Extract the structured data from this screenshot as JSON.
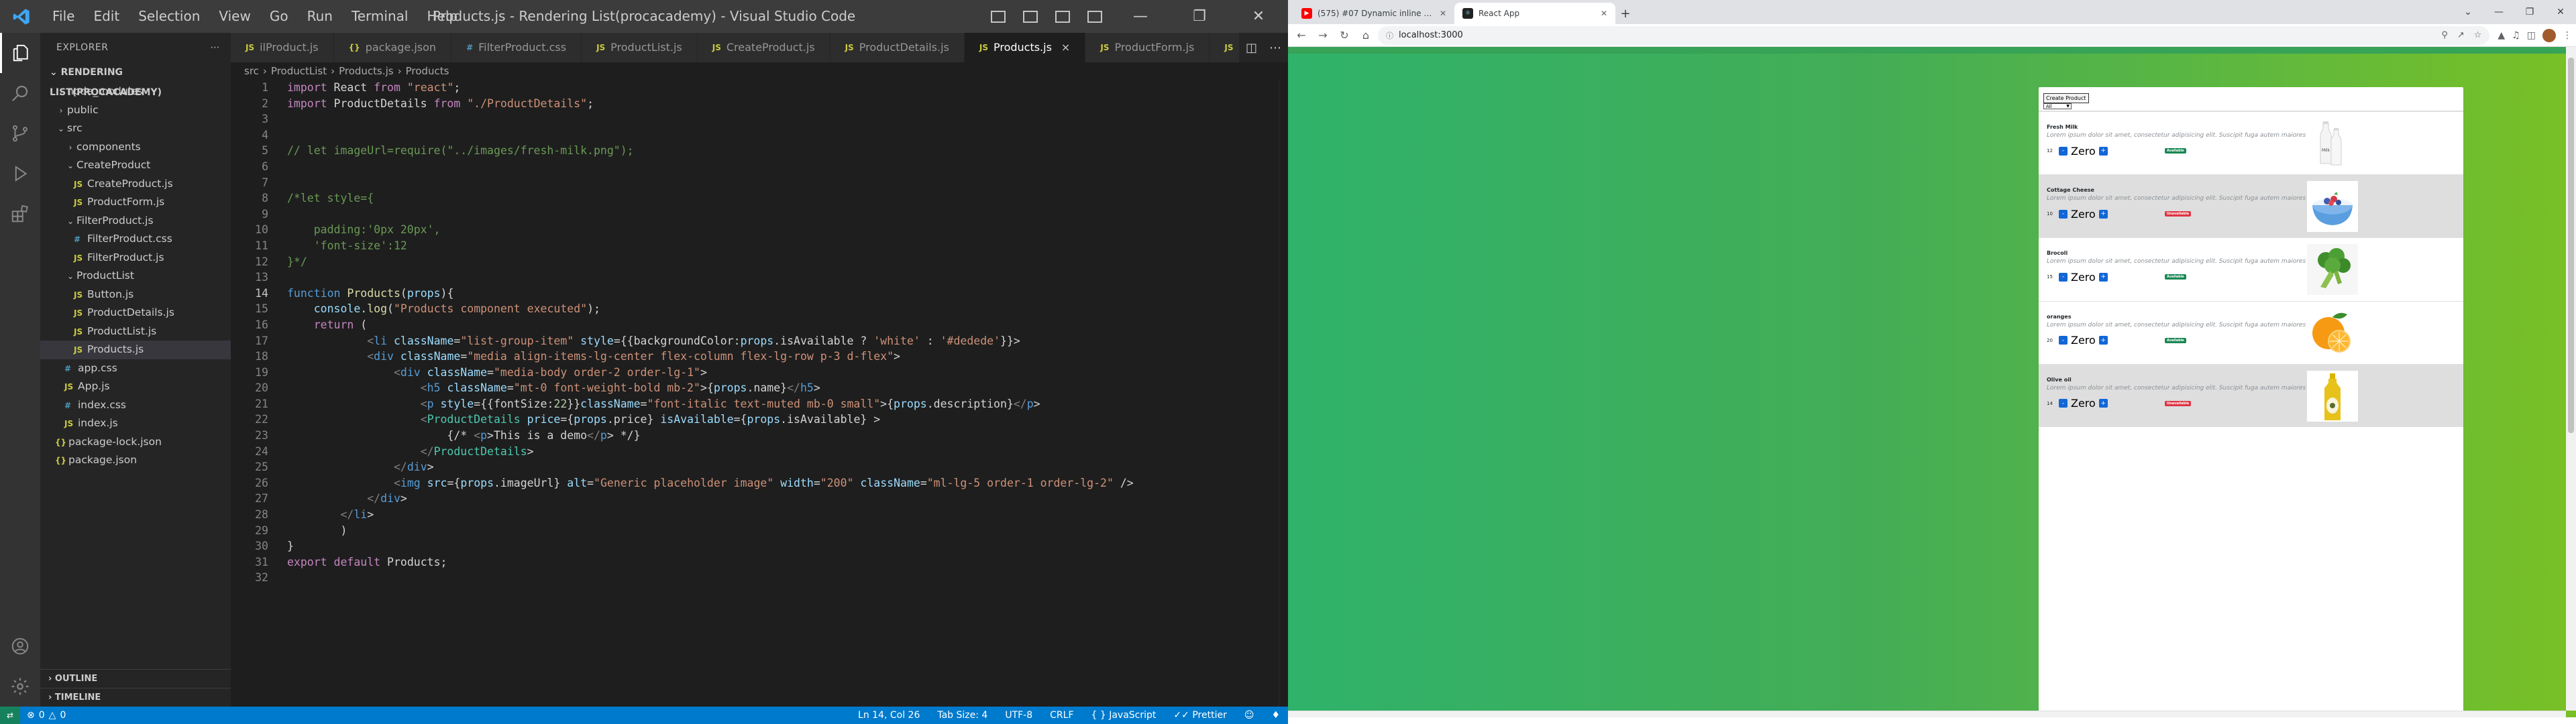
{
  "vscode": {
    "title": "Products.js - Rendering List(procacademy) - Visual Studio Code",
    "menu": [
      "File",
      "Edit",
      "Selection",
      "View",
      "Go",
      "Run",
      "Terminal",
      "Help"
    ],
    "explorer_header": "EXPLORER",
    "project": "RENDERING LIST(PROCACADEMY)",
    "tree": [
      {
        "label": "node_modules",
        "kind": "folder",
        "depth": 0,
        "open": false
      },
      {
        "label": "public",
        "kind": "folder",
        "depth": 0,
        "open": false
      },
      {
        "label": "src",
        "kind": "folder",
        "depth": 0,
        "open": true
      },
      {
        "label": "components",
        "kind": "folder",
        "depth": 1,
        "open": false
      },
      {
        "label": "CreateProduct",
        "kind": "folder",
        "depth": 1,
        "open": true
      },
      {
        "label": "CreateProduct.js",
        "kind": "js",
        "depth": 2
      },
      {
        "label": "ProductForm.js",
        "kind": "js",
        "depth": 2
      },
      {
        "label": "FilterProduct.js",
        "kind": "folder",
        "depth": 1,
        "open": true
      },
      {
        "label": "FilterProduct.css",
        "kind": "css",
        "depth": 2
      },
      {
        "label": "FilterProduct.js",
        "kind": "js",
        "depth": 2
      },
      {
        "label": "ProductList",
        "kind": "folder",
        "depth": 1,
        "open": true
      },
      {
        "label": "Button.js",
        "kind": "js",
        "depth": 2
      },
      {
        "label": "ProductDetails.js",
        "kind": "js",
        "depth": 2
      },
      {
        "label": "ProductList.js",
        "kind": "js",
        "depth": 2
      },
      {
        "label": "Products.js",
        "kind": "js",
        "depth": 2,
        "selected": true
      },
      {
        "label": "app.css",
        "kind": "css",
        "depth": 1
      },
      {
        "label": "App.js",
        "kind": "js",
        "depth": 1
      },
      {
        "label": "index.css",
        "kind": "css",
        "depth": 1
      },
      {
        "label": "index.js",
        "kind": "js",
        "depth": 1
      },
      {
        "label": "package-lock.json",
        "kind": "json",
        "depth": 0
      },
      {
        "label": "package.json",
        "kind": "json",
        "depth": 0
      }
    ],
    "outline_label": "OUTLINE",
    "timeline_label": "TIMELINE",
    "tabs": [
      {
        "label": "ilProduct.js",
        "kind": "js"
      },
      {
        "label": "package.json",
        "kind": "json"
      },
      {
        "label": "FilterProduct.css",
        "kind": "css"
      },
      {
        "label": "ProductList.js",
        "kind": "js"
      },
      {
        "label": "CreateProduct.js",
        "kind": "js"
      },
      {
        "label": "ProductDetails.js",
        "kind": "js"
      },
      {
        "label": "Products.js",
        "kind": "js",
        "active": true
      },
      {
        "label": "ProductForm.js",
        "kind": "js"
      },
      {
        "label": "App.js",
        "kind": "js"
      }
    ],
    "breadcrumb": [
      "src",
      "ProductList",
      "Products.js",
      "Products"
    ],
    "code": [
      "import React from \"react\";",
      "import ProductDetails from \"./ProductDetails\";",
      "",
      "",
      "// let imageUrl=require(\"../images/fresh-milk.png\");",
      "",
      "",
      "/*let style={",
      "",
      "    padding:'0px 20px',",
      "    'font-size':12",
      "}*/",
      "",
      "function Products(props){",
      "    console.log(\"Products component executed\");",
      "    return (",
      "            <li className=\"list-group-item\" style={{backgroundColor:props.isAvailable ? 'white' : '#dedede'}}>",
      "            <div className=\"media align-items-lg-center flex-column flex-lg-row p-3 d-flex\">",
      "                <div className=\"media-body order-2 order-lg-1\">",
      "                    <h5 className=\"mt-0 font-weight-bold mb-2\">{props.name}</h5>",
      "                    <p style={{fontSize:22}}className=\"font-italic text-muted mb-0 small\">{props.description}</p>",
      "                    <ProductDetails price={props.price} isAvailable={props.isAvailable} >",
      "                        {/* <p>This is a demo</p> */}",
      "                    </ProductDetails>",
      "                </div>",
      "                <img src={props.imageUrl} alt=\"Generic placeholder image\" width=\"200\" className=\"ml-lg-5 order-1 order-lg-2\" />",
      "            </div>",
      "        </li>",
      "        )",
      "}",
      "export default Products;",
      ""
    ],
    "status": {
      "errors": "0",
      "warnings": "0",
      "position": "Ln 14, Col 26",
      "tabsize": "Tab Size: 4",
      "encoding": "UTF-8",
      "eol": "CRLF",
      "language": "JavaScript",
      "formatter": "Prettier"
    },
    "colors": {
      "statusbar": "#007acc",
      "editor_bg": "#1e1e1e",
      "sidebar_bg": "#252526",
      "titlebar_bg": "#3c3c3c"
    }
  },
  "chrome": {
    "tabs": [
      {
        "title": "(575) #07 Dynamic inline styling",
        "icon": "youtube-icon",
        "active": false
      },
      {
        "title": "React App",
        "icon": "react-icon",
        "active": true
      }
    ],
    "url": "localhost:3000",
    "new_tab_symbol": "+"
  },
  "app": {
    "create_button": "Create Product",
    "filter_value": "All",
    "products": [
      {
        "name": "Fresh Milk",
        "description": "Lorem ipsum dolor sit amet, consectetur adipisicing elit. Suscipit fuga autem maiores necessitatibus.",
        "price": "12",
        "qty": "Zero",
        "available": true,
        "status": "Available",
        "image": "milk-bottles"
      },
      {
        "name": "Cottage Cheese",
        "description": "Lorem ipsum dolor sit amet, consectetur adipisicing elit. Suscipit fuga autem maiores necessitatibus.",
        "price": "10",
        "qty": "Zero",
        "available": false,
        "status": "Unavailable",
        "image": "cheese-bowl"
      },
      {
        "name": "Brocoli",
        "description": "Lorem ipsum dolor sit amet, consectetur adipisicing elit. Suscipit fuga autem maiores necessitatibus.",
        "price": "15",
        "qty": "Zero",
        "available": true,
        "status": "Available",
        "image": "broccoli"
      },
      {
        "name": "oranges",
        "description": "Lorem ipsum dolor sit amet, consectetur adipisicing elit. Suscipit fuga autem maiores necessitatibus.",
        "price": "20",
        "qty": "Zero",
        "available": true,
        "status": "Available",
        "image": "orange"
      },
      {
        "name": "Olive oil",
        "description": "Lorem ipsum dolor sit amet, consectetur adipisicing elit. Suscipit fuga autem maiores necessitatibus.",
        "price": "14",
        "qty": "Zero",
        "available": false,
        "status": "Unavailable",
        "image": "olive-oil"
      }
    ],
    "minus_symbol": "-",
    "plus_symbol": "+",
    "colors": {
      "available_bg": "#ffffff",
      "unavailable_bg": "#dedede",
      "button": "#1266d6",
      "badge_ok": "#198754",
      "badge_no": "#dc3545"
    }
  }
}
